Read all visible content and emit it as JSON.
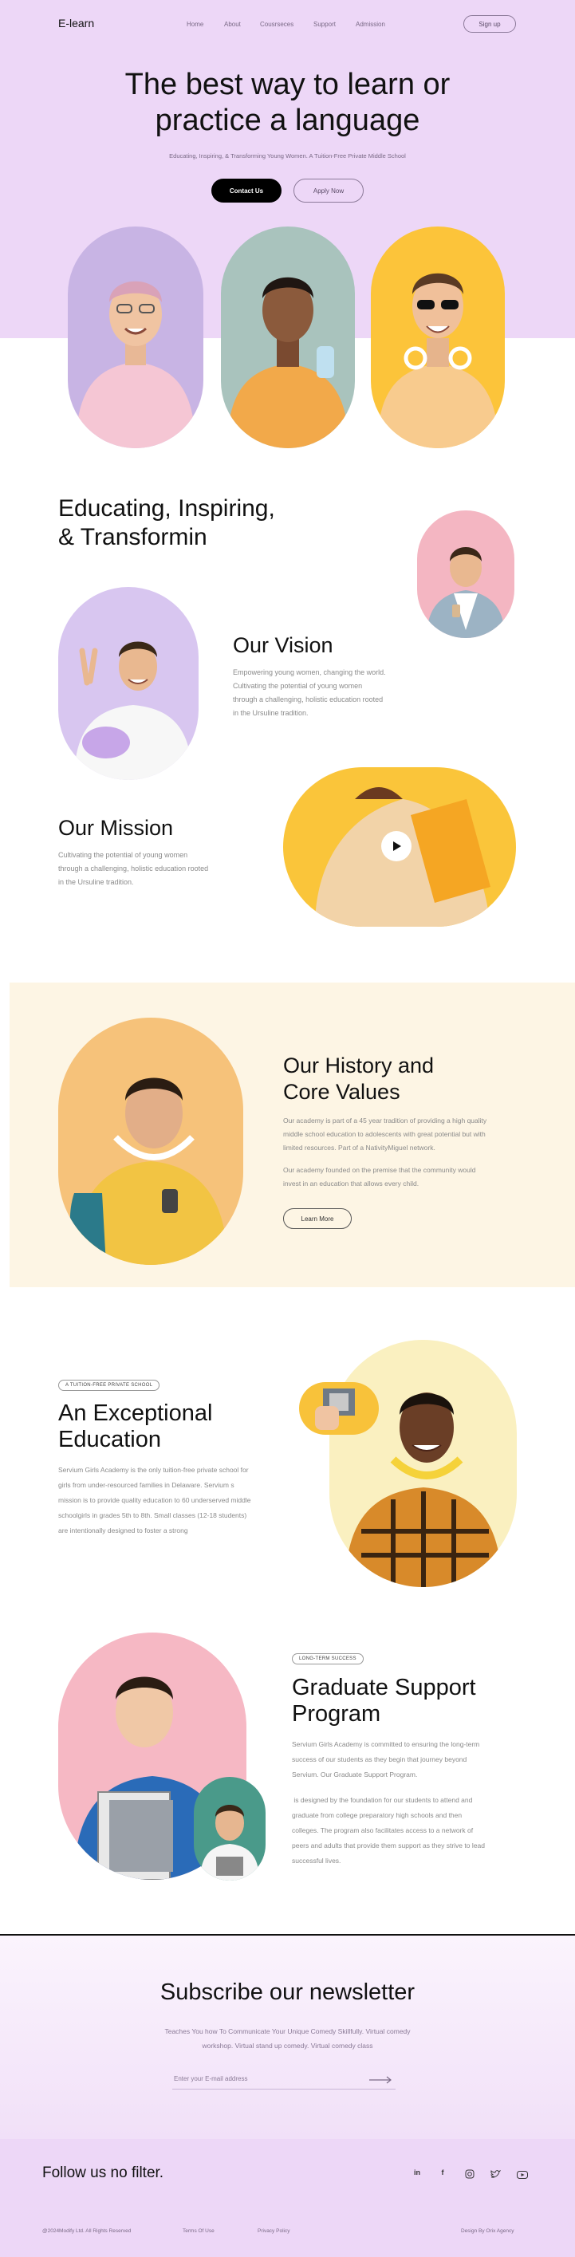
{
  "header": {
    "logo": "E-learn",
    "nav": [
      "Home",
      "About",
      "Cousrseces",
      "Support",
      "Admission"
    ],
    "signup_label": "Sign up"
  },
  "hero": {
    "title_line1": "The best way to learn or",
    "title_line2": "practice a language",
    "subtitle": "Educating, Inspiring, & Transforming Young Women. A Tuition-Free Private Middle School",
    "primary_cta": "Contact Us",
    "secondary_cta": "Apply Now"
  },
  "intro": {
    "heading_line1": "Educating, Inspiring,",
    "heading_line2": "& Transformin"
  },
  "vision": {
    "heading": "Our Vision",
    "text": [
      "Empowering young women, changing the world.",
      "Cultivating the potential of young women",
      "through a challenging, holistic education rooted",
      "in the Ursuline tradition."
    ]
  },
  "mission": {
    "heading": "Our Mission",
    "text": [
      "Cultivating the potential of young women",
      "through a challenging, holistic education rooted",
      "in the Ursuline tradition."
    ]
  },
  "history": {
    "heading_line1": "Our History and",
    "heading_line2": "Core Values",
    "para1": [
      "Our academy is part of a 45 year tradition of providing a high quality",
      "middle school education to adolescents with great potential but with",
      "limited resources. Part of a NativityMiguel network."
    ],
    "para2": [
      "Our academy founded on the premise that the community would",
      "invest in an education that allows every child."
    ],
    "cta": "Learn More"
  },
  "exceptional": {
    "tag": "A TUITION-FREE PRIVATE SCHOOL",
    "heading_line1": "An Exceptional",
    "heading_line2": "Education",
    "text": [
      "Servium Girls Academy is the only tuition-free private school for",
      "girls from under-resourced families in Delaware. Servium s",
      "mission is to provide quality education to 60 underserved middle",
      "schoolgirls in grades 5th to 8th. Small classes (12-18 students)",
      "are intentionally designed to foster a strong"
    ]
  },
  "graduate": {
    "tag": "LONG-TERM SUCCESS",
    "heading_line1": "Graduate Support",
    "heading_line2": "Program",
    "para1": [
      "Servium Girls Academy is committed to ensuring the long-term",
      "success of our students as they begin that journey beyond",
      "Servium. Our Graduate Support Program."
    ],
    "para2": [
      " is designed by the foundation for our students to attend and",
      "graduate from college preparatory high schools and then",
      "colleges. The program also facilitates access to a network of",
      "peers and adults that provide them support as they strive to lead",
      "successful lives."
    ]
  },
  "newsletter": {
    "heading": "Subscribe our newsletter",
    "text_line1": "Teaches You how To Communicate Your Unique Comedy Skillfully. Virtual comedy",
    "text_line2": "workshop. Virtual stand up comedy. Virtual comedy class",
    "email_placeholder": "Enter your E-mail address"
  },
  "footer": {
    "follow": "Follow us no filter.",
    "social": [
      "in",
      "f",
      "ig",
      "tw",
      "yt"
    ],
    "copyright": "@2024Modify Ltd. All Rights Reserved",
    "terms": "Terms Of Use",
    "privacy": "Privacy Policy",
    "credit": "Design By Orix Agency"
  },
  "colors": {
    "lilac": "#edd7f7",
    "cream": "#fdf5e4",
    "black_button": "#000000",
    "pink_oval": "#f4b6c2",
    "orange_oval": "#f6c27a",
    "yellow_oval": "#fac53a",
    "purple_oval": "#d8c6f0"
  }
}
